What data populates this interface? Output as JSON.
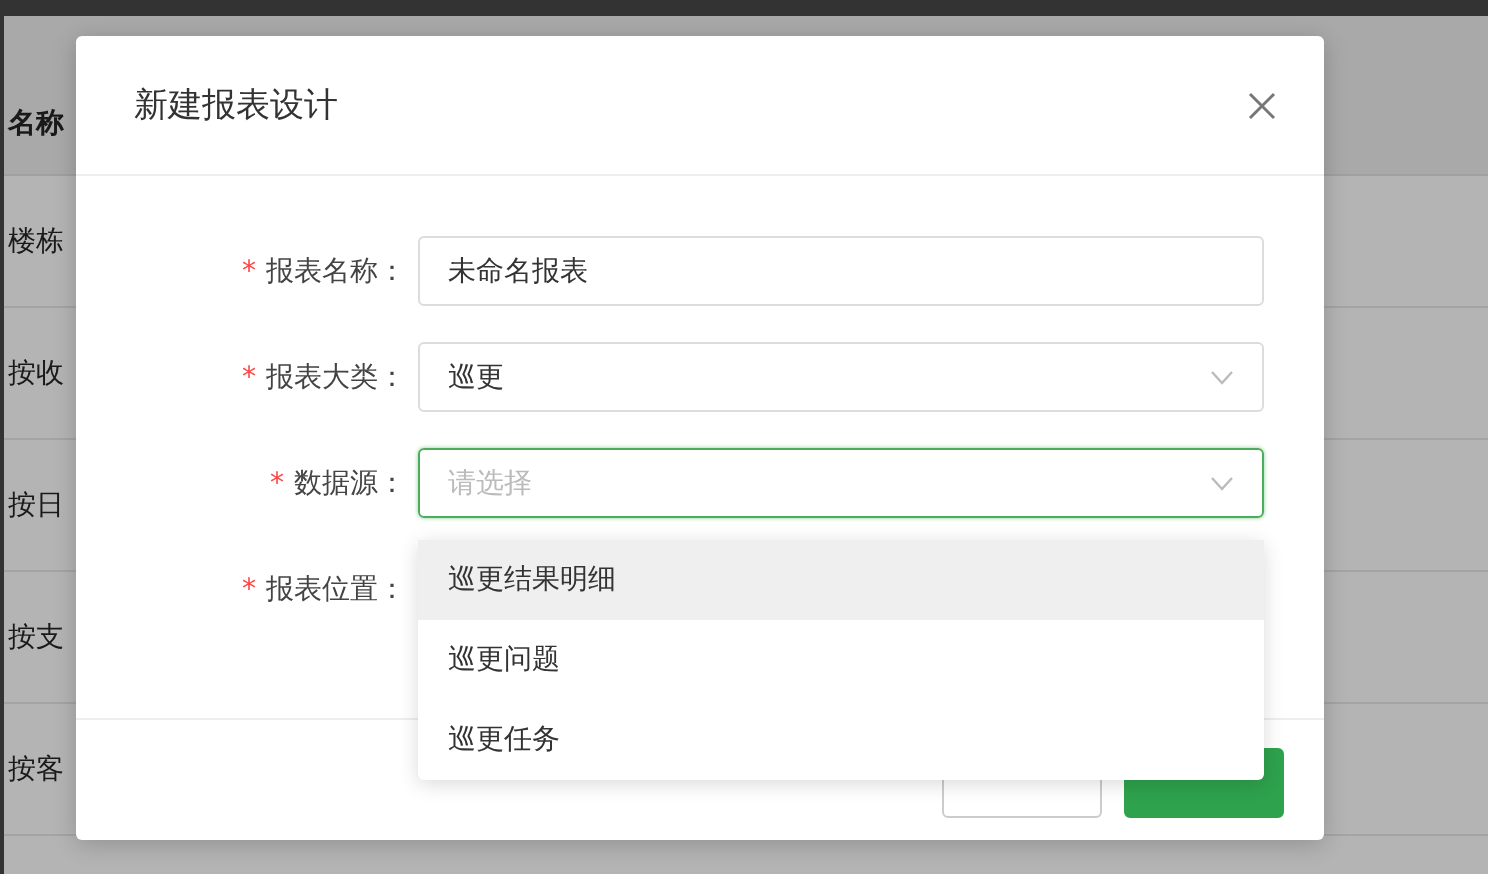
{
  "background_table": {
    "header": "名称",
    "rows": [
      "楼栋",
      "按收",
      "按日",
      "按支",
      "按客"
    ]
  },
  "dialog": {
    "title": "新建报表设计",
    "fields": [
      {
        "label": "报表名称：",
        "marker": "*",
        "kind": "text",
        "value": "未命名报表",
        "focused": false
      },
      {
        "label": "报表大类：",
        "marker": "*",
        "kind": "select",
        "value": "巡更",
        "focused": false
      },
      {
        "label": "数据源：",
        "marker": "*",
        "kind": "select",
        "placeholder": "请选择",
        "focused": true
      },
      {
        "label": "报表位置：",
        "marker": "*",
        "kind": "covered"
      }
    ],
    "dropdown": {
      "options": [
        {
          "label": "巡更结果明细",
          "highlighted": true,
          "selected": false
        },
        {
          "label": "巡更问题",
          "highlighted": false,
          "selected": false
        },
        {
          "label": "巡更任务",
          "highlighted": false,
          "selected": false
        }
      ]
    },
    "buttons": [
      {
        "kind": "default"
      },
      {
        "kind": "primary"
      }
    ]
  }
}
